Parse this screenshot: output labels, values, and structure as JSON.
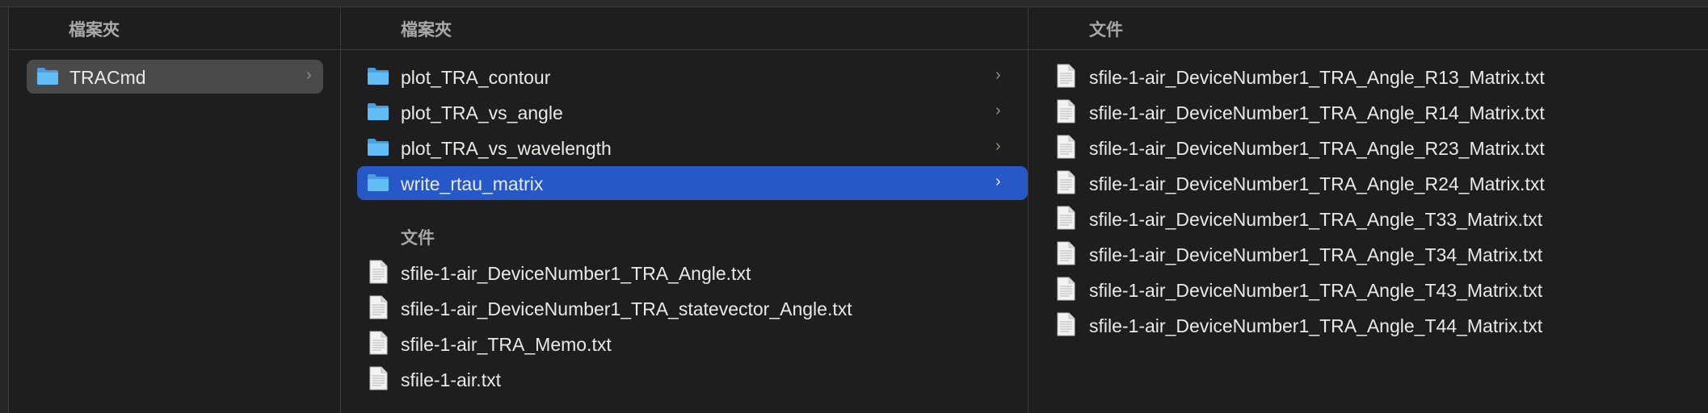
{
  "columns": [
    {
      "header": "檔案夾",
      "folders": [
        {
          "name": "TRACmd",
          "selected": true
        }
      ]
    },
    {
      "header": "檔案夾",
      "folders": [
        {
          "name": "plot_TRA_contour"
        },
        {
          "name": "plot_TRA_vs_angle"
        },
        {
          "name": "plot_TRA_vs_wavelength"
        },
        {
          "name": "write_rtau_matrix",
          "selected": true
        }
      ],
      "files_header": "文件",
      "files": [
        "sfile-1-air_DeviceNumber1_TRA_Angle.txt",
        "sfile-1-air_DeviceNumber1_TRA_statevector_Angle.txt",
        "sfile-1-air_TRA_Memo.txt",
        "sfile-1-air.txt"
      ]
    },
    {
      "header": "文件",
      "files": [
        "sfile-1-air_DeviceNumber1_TRA_Angle_R13_Matrix.txt",
        "sfile-1-air_DeviceNumber1_TRA_Angle_R14_Matrix.txt",
        "sfile-1-air_DeviceNumber1_TRA_Angle_R23_Matrix.txt",
        "sfile-1-air_DeviceNumber1_TRA_Angle_R24_Matrix.txt",
        "sfile-1-air_DeviceNumber1_TRA_Angle_T33_Matrix.txt",
        "sfile-1-air_DeviceNumber1_TRA_Angle_T34_Matrix.txt",
        "sfile-1-air_DeviceNumber1_TRA_Angle_T43_Matrix.txt",
        "sfile-1-air_DeviceNumber1_TRA_Angle_T44_Matrix.txt"
      ]
    }
  ],
  "chevron": "›",
  "icons": {
    "folder": "folder-icon",
    "file": "text-document-icon",
    "chevron": "chevron-right-icon"
  },
  "colors": {
    "selection_active": "#2758c8",
    "selection_inactive": "#4a4a4a",
    "folder": "#5ab4f0"
  }
}
